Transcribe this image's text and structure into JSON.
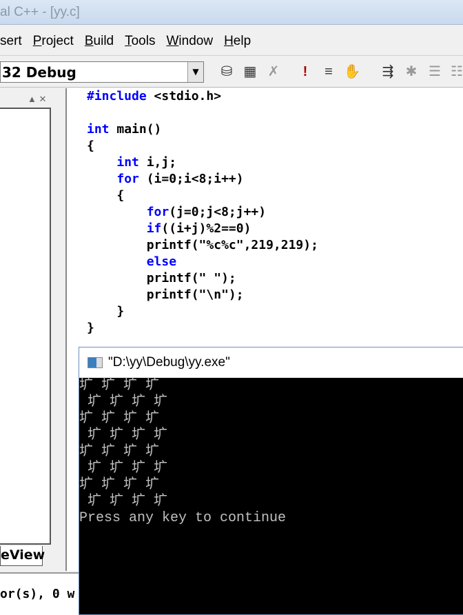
{
  "window": {
    "title": "al C++ - [yy.c]"
  },
  "menu": [
    {
      "pre": "",
      "u": "",
      "rest": "sert"
    },
    {
      "pre": "",
      "u": "P",
      "rest": "roject"
    },
    {
      "pre": "",
      "u": "B",
      "rest": "uild"
    },
    {
      "pre": "",
      "u": "T",
      "rest": "ools"
    },
    {
      "pre": "",
      "u": "W",
      "rest": "indow"
    },
    {
      "pre": "",
      "u": "H",
      "rest": "elp"
    }
  ],
  "toolbar": {
    "config": "32 Debug",
    "icons": [
      "compile-icon",
      "build-icon",
      "stop-build-icon",
      "execute-icon",
      "go-icon",
      "breakpoint-icon",
      "wizard-icon",
      "class-icon",
      "members-icon",
      "function-icon"
    ]
  },
  "left_panel": {
    "tab": "eView"
  },
  "code": [
    [
      {
        "t": "#include",
        "k": 1
      },
      {
        "t": " <stdio.h>",
        "k": 0
      }
    ],
    [],
    [
      {
        "t": "int",
        "k": 1
      },
      {
        "t": " main()",
        "k": 0
      }
    ],
    [
      {
        "t": "{",
        "k": 0
      }
    ],
    [
      {
        "t": "    ",
        "k": 0
      },
      {
        "t": "int",
        "k": 1
      },
      {
        "t": " i,j;",
        "k": 0
      }
    ],
    [
      {
        "t": "    ",
        "k": 0
      },
      {
        "t": "for",
        "k": 1
      },
      {
        "t": " (i=0;i<8;i++)",
        "k": 0
      }
    ],
    [
      {
        "t": "    {",
        "k": 0
      }
    ],
    [
      {
        "t": "        ",
        "k": 0
      },
      {
        "t": "for",
        "k": 1
      },
      {
        "t": "(j=0;j<8;j++)",
        "k": 0
      }
    ],
    [
      {
        "t": "        ",
        "k": 0
      },
      {
        "t": "if",
        "k": 1
      },
      {
        "t": "((i+j)%2==0)",
        "k": 0
      }
    ],
    [
      {
        "t": "        printf(\"%c%c\",219,219);",
        "k": 0
      }
    ],
    [
      {
        "t": "        ",
        "k": 0
      },
      {
        "t": "else",
        "k": 1
      }
    ],
    [
      {
        "t": "        printf(\" \");",
        "k": 0
      }
    ],
    [
      {
        "t": "        printf(\"\\n\");",
        "k": 0
      }
    ],
    [
      {
        "t": "    }",
        "k": 0
      }
    ],
    [
      {
        "t": "}",
        "k": 0
      }
    ]
  ],
  "output": {
    "text": "or(s), 0 w"
  },
  "console": {
    "title": "\"D:\\yy\\Debug\\yy.exe\"",
    "lines": [
      "圹 圹 圹 圹",
      " 圹 圹 圹 圹",
      "圹 圹 圹 圹",
      " 圹 圹 圹 圹",
      "圹 圹 圹 圹",
      " 圹 圹 圹 圹",
      "圹 圹 圹 圹",
      " 圹 圹 圹 圹",
      "Press any key to continue"
    ]
  }
}
